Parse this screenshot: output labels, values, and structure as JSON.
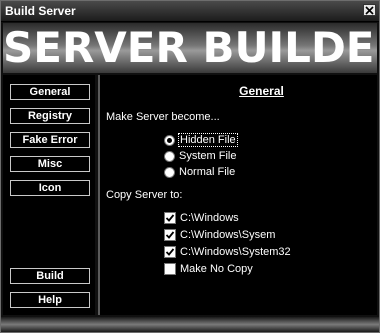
{
  "window": {
    "title": "Build Server"
  },
  "banner": {
    "text": "SERVER BUILDER"
  },
  "sidebar": {
    "top_items": [
      {
        "label": "General"
      },
      {
        "label": "Registry"
      },
      {
        "label": "Fake Error"
      },
      {
        "label": "Misc"
      },
      {
        "label": "Icon"
      }
    ],
    "bottom_items": [
      {
        "label": "Build"
      },
      {
        "label": "Help"
      }
    ]
  },
  "panel": {
    "title": "General",
    "make_server_label": "Make Server become...",
    "radio_options": [
      {
        "label": "Hidden File",
        "selected": true
      },
      {
        "label": "System File",
        "selected": false
      },
      {
        "label": "Normal File",
        "selected": false
      }
    ],
    "copy_label": "Copy Server to:",
    "check_options": [
      {
        "label": "C:\\Windows",
        "checked": true
      },
      {
        "label": "C:\\Windows\\Sysem",
        "checked": true
      },
      {
        "label": "C:\\Windows\\System32",
        "checked": true
      },
      {
        "label": "Make No Copy",
        "checked": false
      }
    ]
  },
  "colors": {
    "accent": "#ffffff",
    "background": "#000000",
    "border": "#c9c9c9"
  }
}
